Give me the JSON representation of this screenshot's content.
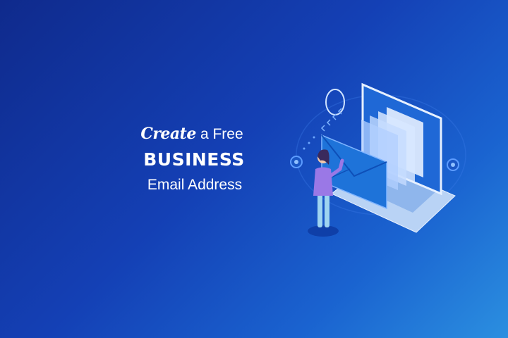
{
  "headline": {
    "line1_script": "Create",
    "line1_rest": "a Free",
    "line2": "BUSINESS",
    "line3": "Email Address"
  },
  "colors": {
    "background_start": "#0f2a8c",
    "background_end": "#2b8fe0",
    "text": "#ffffff",
    "envelope": "#1e73d9",
    "screen_card": "#e6f0ff"
  },
  "illustration": {
    "icons": [
      "laptop-icon",
      "envelope-icon",
      "email-card-icon",
      "person-figure",
      "chevron-icon",
      "cloud-ring-icon"
    ]
  }
}
